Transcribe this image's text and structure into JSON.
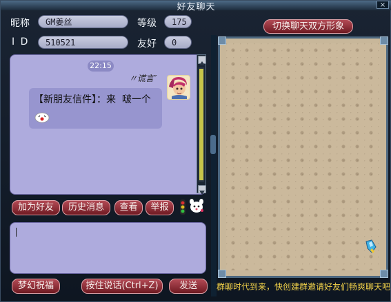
{
  "window": {
    "title": "好友聊天",
    "close_glyph": "×"
  },
  "profile": {
    "nickname_label": "昵称",
    "nickname_value": "GM姜丝",
    "level_label": "等级",
    "level_value": "175",
    "id_label": "I D",
    "id_value": "510521",
    "friendship_label": "友好",
    "friendship_value": "0"
  },
  "chat": {
    "timestamp": "22:15",
    "sender_name": "〃谎言″",
    "message_text": "【新朋友信件】：来  啵一个"
  },
  "actions": {
    "add_friend": "加为好友",
    "history": "历史消息",
    "view": "查看",
    "report": "举报"
  },
  "bottom": {
    "blessing": "梦幻祝福",
    "push_to_talk": "按住说话(Ctrl+Z)",
    "send": "发送"
  },
  "right_panel": {
    "switch_appearance": "切换聊天双方形象",
    "group_chat_notice": "群聊时代到来，快创建群邀请好友们畅爽聊天吧"
  },
  "icons": [
    "close-icon",
    "avatar",
    "emoji-icon",
    "traffic-light-icon",
    "pet-icon",
    "gem-icon"
  ],
  "colors": {
    "chat_panel": "#aeabdd",
    "button": "#8c2a33",
    "notice_text": "#f2d24a"
  }
}
